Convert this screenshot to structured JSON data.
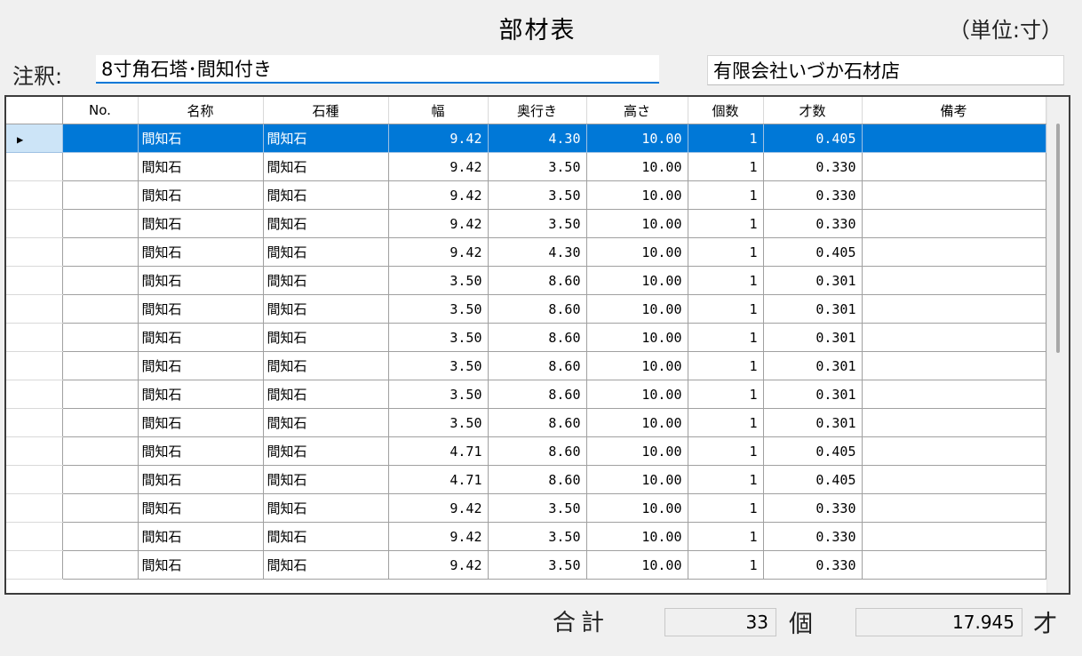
{
  "title": "部材表",
  "unit": "（単位:寸）",
  "note": {
    "label": "注釈:",
    "value": "8寸角石塔･間知付き"
  },
  "company": "有限会社いづか石材店",
  "table": {
    "columns": [
      "No.",
      "名称",
      "石種",
      "幅",
      "奥行き",
      "高さ",
      "個数",
      "才数",
      "備考"
    ],
    "selected_row": 0,
    "rows": [
      {
        "no": "",
        "name": "間知石",
        "stone": "間知石",
        "width": "9.42",
        "depth": "4.30",
        "height": "10.00",
        "count": "1",
        "saisu": "0.405",
        "remarks": ""
      },
      {
        "no": "",
        "name": "間知石",
        "stone": "間知石",
        "width": "9.42",
        "depth": "3.50",
        "height": "10.00",
        "count": "1",
        "saisu": "0.330",
        "remarks": ""
      },
      {
        "no": "",
        "name": "間知石",
        "stone": "間知石",
        "width": "9.42",
        "depth": "3.50",
        "height": "10.00",
        "count": "1",
        "saisu": "0.330",
        "remarks": ""
      },
      {
        "no": "",
        "name": "間知石",
        "stone": "間知石",
        "width": "9.42",
        "depth": "3.50",
        "height": "10.00",
        "count": "1",
        "saisu": "0.330",
        "remarks": ""
      },
      {
        "no": "",
        "name": "間知石",
        "stone": "間知石",
        "width": "9.42",
        "depth": "4.30",
        "height": "10.00",
        "count": "1",
        "saisu": "0.405",
        "remarks": ""
      },
      {
        "no": "",
        "name": "間知石",
        "stone": "間知石",
        "width": "3.50",
        "depth": "8.60",
        "height": "10.00",
        "count": "1",
        "saisu": "0.301",
        "remarks": ""
      },
      {
        "no": "",
        "name": "間知石",
        "stone": "間知石",
        "width": "3.50",
        "depth": "8.60",
        "height": "10.00",
        "count": "1",
        "saisu": "0.301",
        "remarks": ""
      },
      {
        "no": "",
        "name": "間知石",
        "stone": "間知石",
        "width": "3.50",
        "depth": "8.60",
        "height": "10.00",
        "count": "1",
        "saisu": "0.301",
        "remarks": ""
      },
      {
        "no": "",
        "name": "間知石",
        "stone": "間知石",
        "width": "3.50",
        "depth": "8.60",
        "height": "10.00",
        "count": "1",
        "saisu": "0.301",
        "remarks": ""
      },
      {
        "no": "",
        "name": "間知石",
        "stone": "間知石",
        "width": "3.50",
        "depth": "8.60",
        "height": "10.00",
        "count": "1",
        "saisu": "0.301",
        "remarks": ""
      },
      {
        "no": "",
        "name": "間知石",
        "stone": "間知石",
        "width": "3.50",
        "depth": "8.60",
        "height": "10.00",
        "count": "1",
        "saisu": "0.301",
        "remarks": ""
      },
      {
        "no": "",
        "name": "間知石",
        "stone": "間知石",
        "width": "4.71",
        "depth": "8.60",
        "height": "10.00",
        "count": "1",
        "saisu": "0.405",
        "remarks": ""
      },
      {
        "no": "",
        "name": "間知石",
        "stone": "間知石",
        "width": "4.71",
        "depth": "8.60",
        "height": "10.00",
        "count": "1",
        "saisu": "0.405",
        "remarks": ""
      },
      {
        "no": "",
        "name": "間知石",
        "stone": "間知石",
        "width": "9.42",
        "depth": "3.50",
        "height": "10.00",
        "count": "1",
        "saisu": "0.330",
        "remarks": ""
      },
      {
        "no": "",
        "name": "間知石",
        "stone": "間知石",
        "width": "9.42",
        "depth": "3.50",
        "height": "10.00",
        "count": "1",
        "saisu": "0.330",
        "remarks": ""
      },
      {
        "no": "",
        "name": "間知石",
        "stone": "間知石",
        "width": "9.42",
        "depth": "3.50",
        "height": "10.00",
        "count": "1",
        "saisu": "0.330",
        "remarks": ""
      }
    ]
  },
  "totals": {
    "label": "合計",
    "count": "33",
    "count_unit": "個",
    "saisu": "17.945",
    "saisu_unit": "才"
  },
  "colors": {
    "selection": "#0078d7",
    "focus_underline": "#0078d7"
  },
  "icons": {
    "row_indicator": "triangle-right-icon"
  }
}
